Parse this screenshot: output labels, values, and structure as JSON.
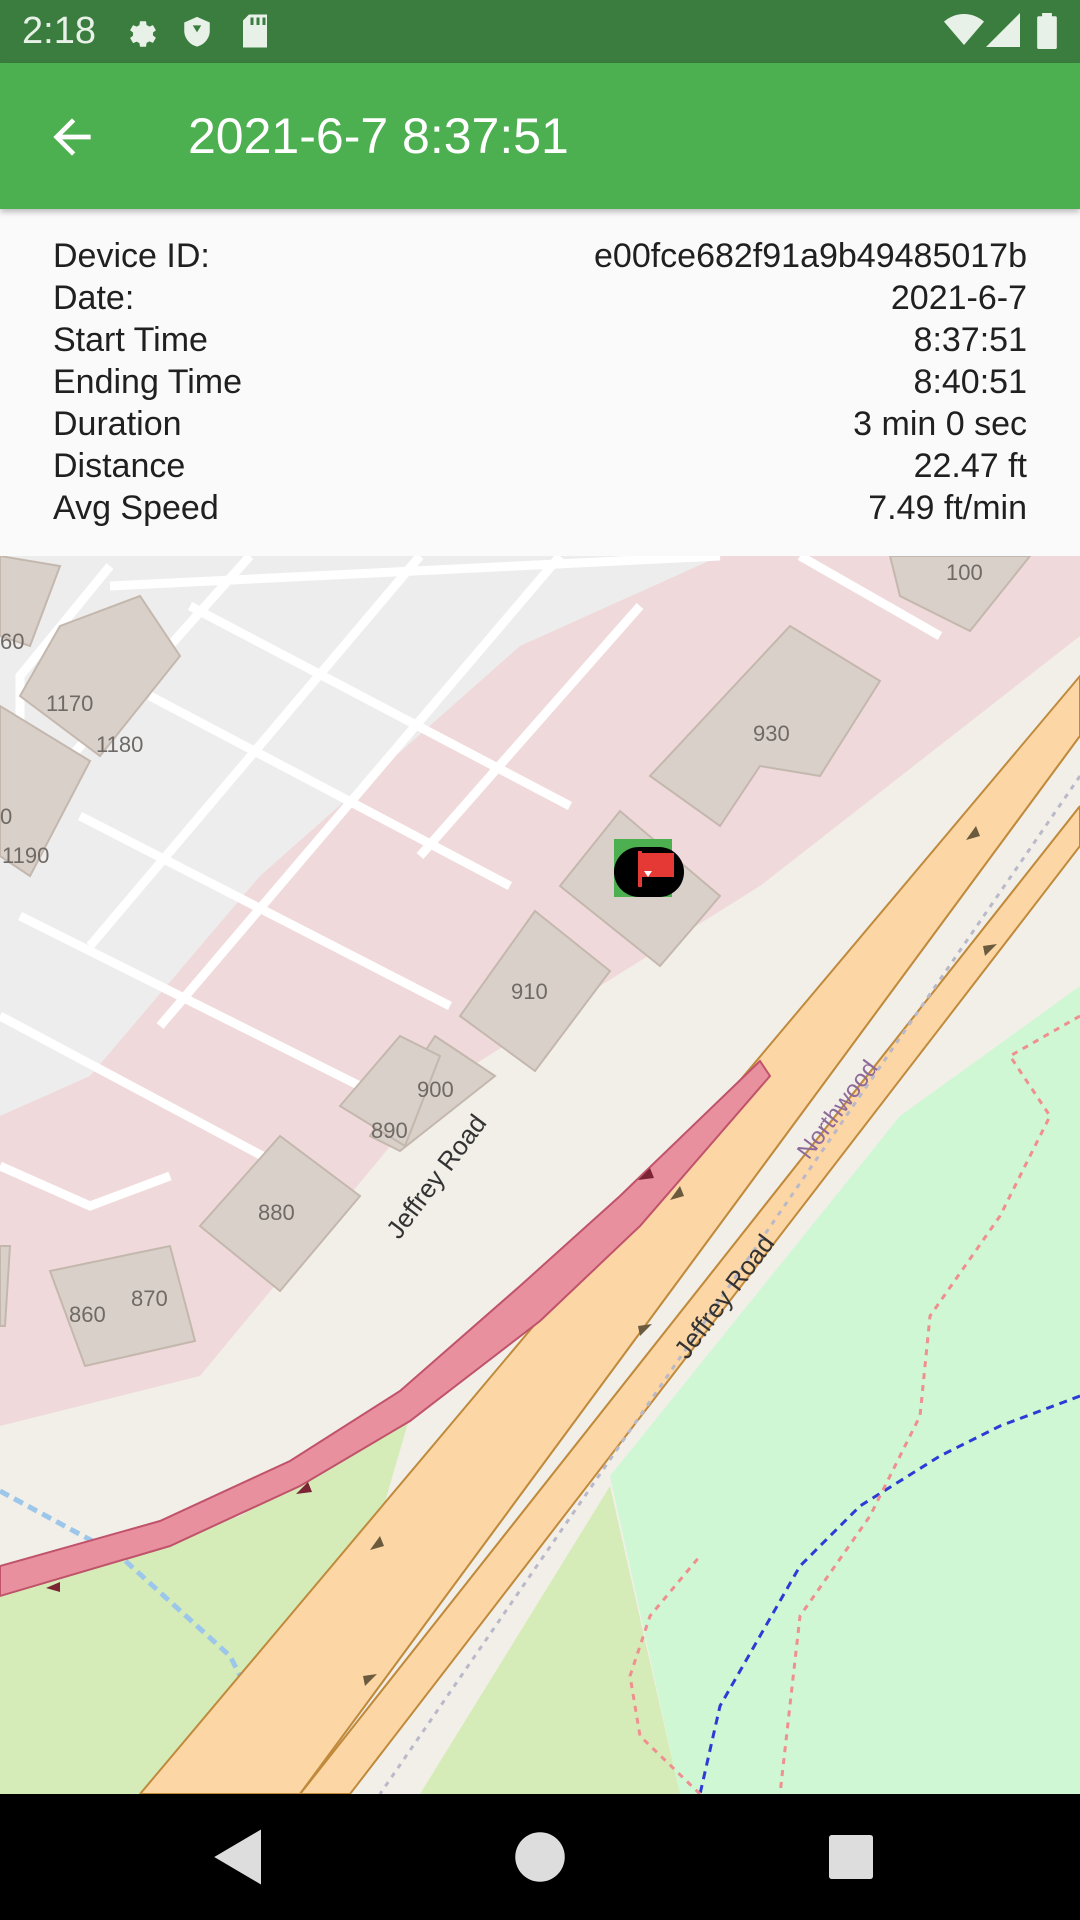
{
  "status_bar": {
    "time": "2:18",
    "icons": [
      "settings-icon",
      "shield-icon",
      "sd-card-icon",
      "wifi-icon",
      "cell-signal-icon",
      "battery-icon"
    ]
  },
  "app_bar": {
    "title": "2021-6-7 8:37:51",
    "back_icon": "arrow-back-icon",
    "color": "#4caf50"
  },
  "details": [
    {
      "label": "Device ID:",
      "value": "e00fce682f91a9b49485017b"
    },
    {
      "label": "Date:",
      "value": "2021-6-7"
    },
    {
      "label": "Start Time",
      "value": "8:37:51"
    },
    {
      "label": "Ending Time",
      "value": "8:40:51"
    },
    {
      "label": "Duration",
      "value": "3 min 0 sec"
    },
    {
      "label": "Distance",
      "value": "22.47 ft"
    },
    {
      "label": "Avg Speed",
      "value": "7.49 ft/min"
    }
  ],
  "map": {
    "building_numbers": [
      "100",
      "930",
      "1170",
      "1180",
      "1190",
      "60",
      "0",
      "910",
      "900",
      "890",
      "880",
      "860",
      "870"
    ],
    "road_labels": [
      "Jeffrey Road",
      "Jeffrey Road",
      "Northwood"
    ],
    "marker_icon": "red-flag-icon"
  },
  "nav_bar": {
    "icons": [
      "back-triangle-icon",
      "home-circle-icon",
      "recents-square-icon"
    ]
  }
}
